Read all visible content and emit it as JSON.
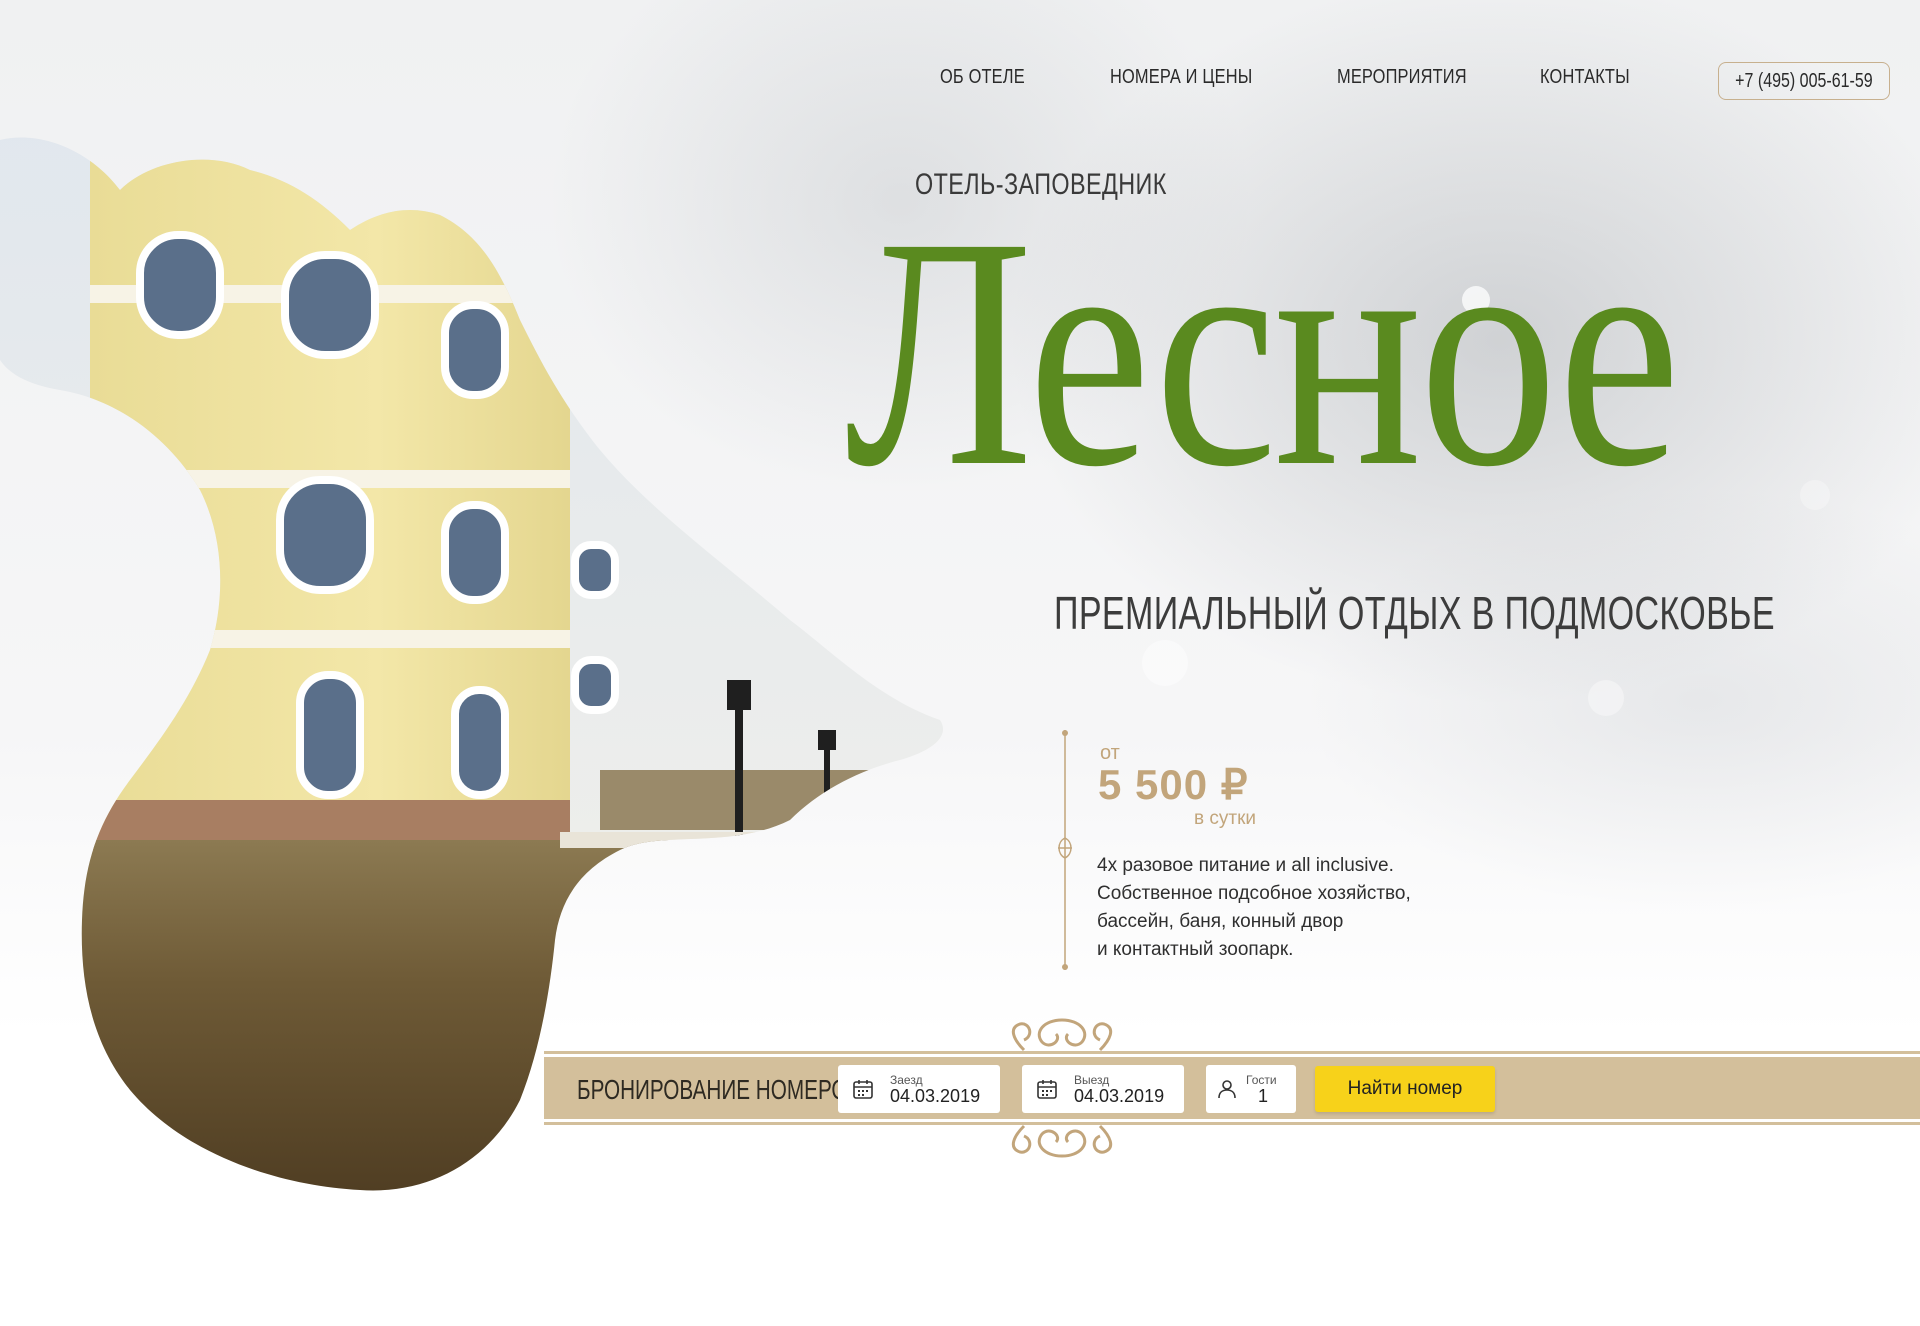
{
  "nav": {
    "items": [
      {
        "label": "ОБ ОТЕЛЕ"
      },
      {
        "label": "НОМЕРА И ЦЕНЫ"
      },
      {
        "label": "МЕРОПРИЯТИЯ"
      },
      {
        "label": "КОНТАКТЫ"
      }
    ],
    "phone": "+7 (495) 005-61-59"
  },
  "hero": {
    "eyebrow": "ОТЕЛЬ-ЗАПОВЕДНИК",
    "title": "Лесное",
    "subtitle": "ПРЕМИАЛЬНЫЙ ОТДЫХ В ПОДМОСКОВЬЕ"
  },
  "price": {
    "from": "от",
    "value": "5 500 ₽",
    "unit": "в сутки"
  },
  "features": [
    "4х разовое питание и all inclusive.",
    "Собственное подсобное хозяйство,",
    "бассейн, баня, конный двор",
    "и контактный зоопарк."
  ],
  "booking": {
    "title": "БРОНИРОВАНИЕ НОМЕРОВ",
    "checkin": {
      "label": "Заезд",
      "value": "04.03.2019"
    },
    "checkout": {
      "label": "Выезд",
      "value": "04.03.2019"
    },
    "guests": {
      "label": "Гости",
      "value": "1"
    },
    "search_label": "Найти номер"
  },
  "colors": {
    "brand_green": "#5a8a1f",
    "gold": "#c2a57b",
    "booking_bar": "#d3bf9b",
    "cta_yellow": "#f7d21a"
  },
  "icons": {
    "calendar": "calendar-icon",
    "user": "user-icon",
    "ornament": "ornament-icon"
  }
}
